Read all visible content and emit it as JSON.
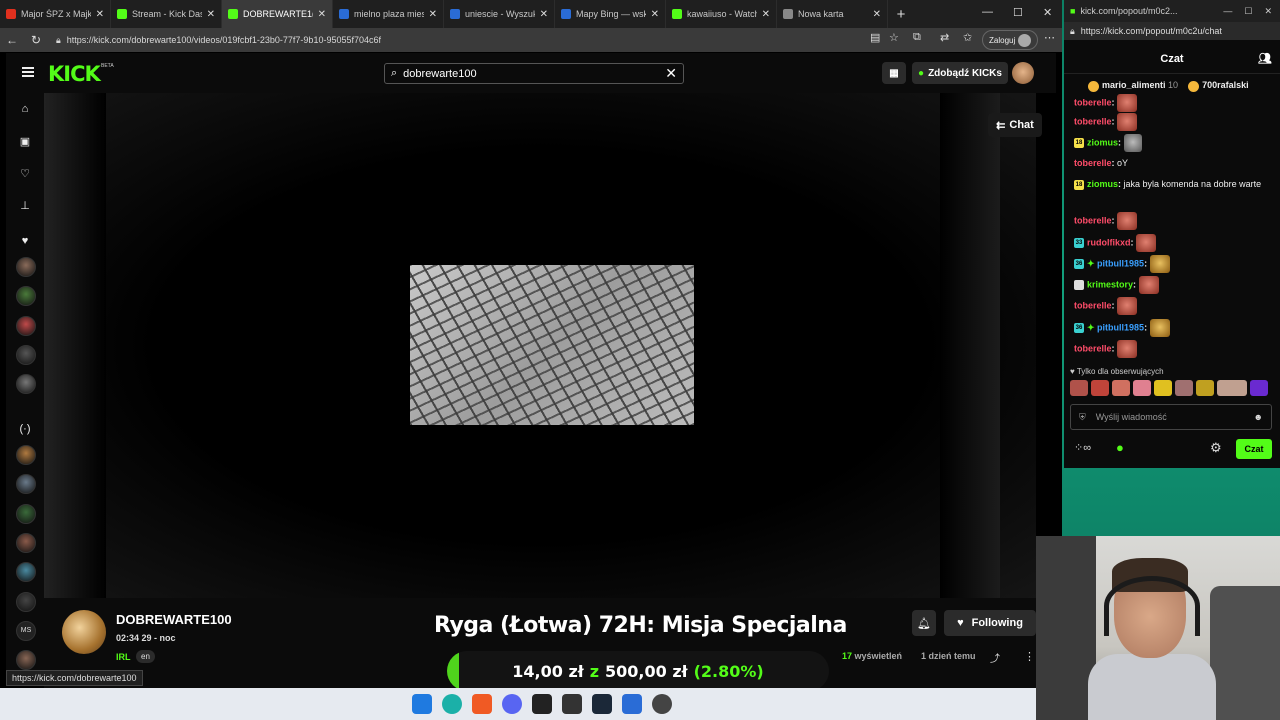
{
  "browser": {
    "tabs": [
      {
        "label": "Major ŚPZ x Majki -",
        "color": "#e0301e"
      },
      {
        "label": "Stream - Kick Dashb",
        "color": "#53fc18"
      },
      {
        "label": "DOBREWARTE1(",
        "color": "#53fc18",
        "active": true
      },
      {
        "label": "mielno plaza mieszk",
        "color": "#2a6cd6"
      },
      {
        "label": "uniescie - Wyszukaj",
        "color": "#2a6cd6"
      },
      {
        "label": "Mapy Bing — wskaz",
        "color": "#2a6cd6"
      },
      {
        "label": "kawaiiuso - Watch th",
        "color": "#53fc18"
      },
      {
        "label": "Nowa karta",
        "color": "#888888"
      }
    ],
    "url": "https://kick.com/dobrewarte100/videos/019fcbf1-23b0-77f7-9b10-95055f704c6f",
    "login_label": "Zaloguj",
    "status_url": "https://kick.com/dobrewarte100"
  },
  "kick": {
    "logo": "KICK",
    "beta": "BETA",
    "search_value": "dobrewarte100",
    "kicks_label": "Zdobądź KICKs",
    "chat_toggle_label": "Chat",
    "accent": "#53fc18"
  },
  "sidebar": {
    "icons": [
      "home-icon",
      "browse-icon",
      "following-icon",
      "categories-icon"
    ],
    "avatar_colors": [
      "#8a6b5a",
      "#4a7a3a",
      "#c04a4a",
      "#555555",
      "#777777",
      "#b07a40",
      "#6a7a8a",
      "#3a6a3a",
      "#8a5a4a",
      "#4a8aa0",
      "#444444",
      "#9a3ac0",
      "#886655"
    ],
    "ms_label": "MS"
  },
  "stream": {
    "channel": "DOBREWARTE100",
    "time": "02:34 29 - noc",
    "tag": "IRL",
    "lang": "en",
    "title": "Ryga (Łotwa) 72H: Misja Specjalna",
    "following_label": "Following",
    "views_count": "17",
    "views_label": "wyświetleń",
    "ago": "1 dzień temu"
  },
  "donation": {
    "current": "14,00 zł",
    "sep": "z",
    "goal": "500,00 zł",
    "percent_text": "(2.80%)",
    "progress": 0.028
  },
  "chat_popout": {
    "url_title": "kick.com/popout/m0c2...",
    "url": "https://kick.com/popout/m0c2u/chat",
    "header": "Czat",
    "pinned": [
      {
        "name": "mario_alimenti",
        "count": "10"
      },
      {
        "name": "700rafalski",
        "count": ""
      }
    ],
    "messages": [
      {
        "user": "toberelle",
        "color": "#ff4d6a",
        "text": "",
        "emote": "red"
      },
      {
        "user": "toberelle",
        "color": "#ff4d6a",
        "text": "",
        "emote": "red"
      },
      {
        "user": "ziomus",
        "color": "#53fc18",
        "badge": "18",
        "badge_color": "#f5e04a",
        "text": "",
        "emote": "gray"
      },
      {
        "user": "toberelle",
        "color": "#ff4d6a",
        "text": "oY",
        "emote": ""
      },
      {
        "user": "ziomus",
        "color": "#53fc18",
        "badge": "18",
        "badge_color": "#f5e04a",
        "text": "jaka byla komenda na dobre warte",
        "emote": ""
      },
      {
        "user": "toberelle",
        "color": "#ff4d6a",
        "text": "",
        "emote": "red"
      },
      {
        "user": "rudolfikxd",
        "color": "#ff4d6a",
        "badge": "33",
        "badge_color": "#3ad0d0",
        "text": "",
        "emote": "red"
      },
      {
        "user": "pitbull1985",
        "color": "#3aa0ff",
        "badge": "36",
        "badge_color": "#3ad0d0",
        "text": "",
        "emote": "gold"
      },
      {
        "user": "krimestory",
        "color": "#53fc18",
        "badge": "",
        "badge_color": "#dddddd",
        "text": "",
        "emote": "red"
      },
      {
        "user": "toberelle",
        "color": "#ff4d6a",
        "text": "",
        "emote": "red"
      },
      {
        "user": "pitbull1985",
        "color": "#3aa0ff",
        "badge": "36",
        "badge_color": "#3ad0d0",
        "text": "",
        "emote": "gold"
      },
      {
        "user": "toberelle",
        "color": "#ff4d6a",
        "text": "",
        "emote": "red"
      }
    ],
    "followers_only": "Tylko dla obserwujących",
    "input_placeholder": "Wyślij wiadomość",
    "send_label": "Czat"
  }
}
